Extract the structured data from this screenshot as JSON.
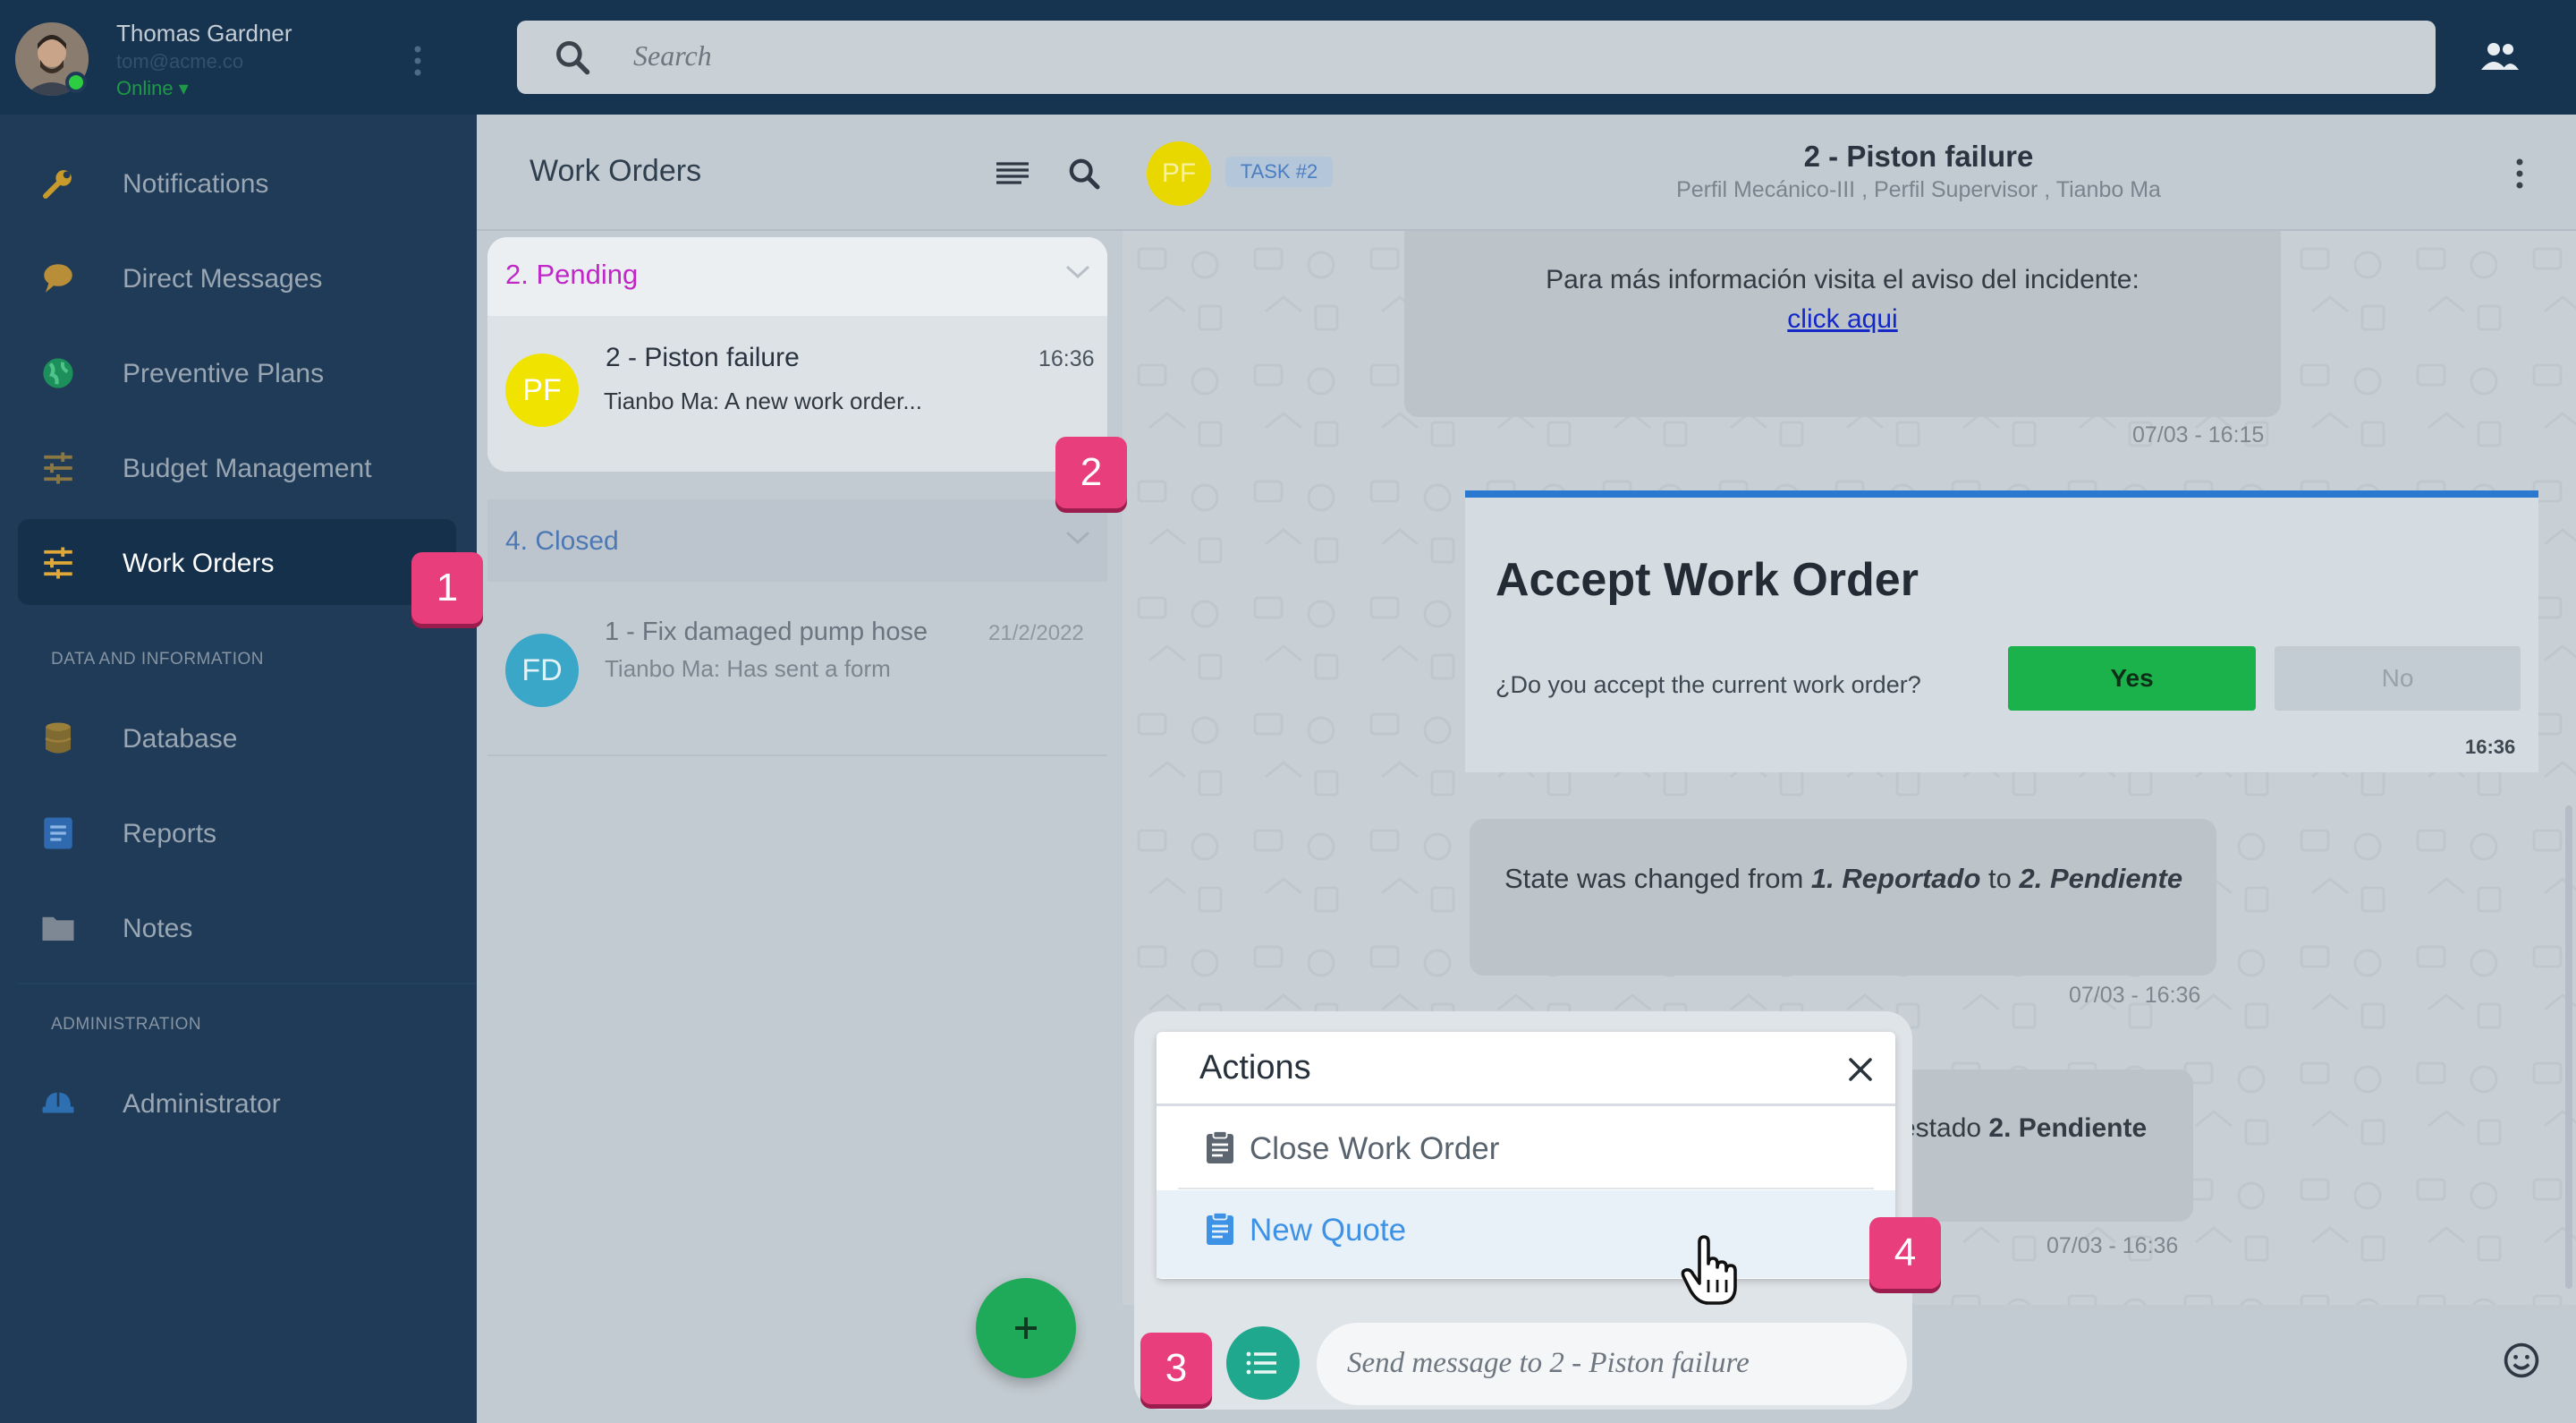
{
  "user": {
    "name": "Thomas Gardner",
    "email": "tom@acme.co",
    "status": "Online ▾"
  },
  "search": {
    "placeholder": "Search"
  },
  "sidebar": {
    "items": [
      {
        "label": "Notifications",
        "icon": "wrench-icon"
      },
      {
        "label": "Direct Messages",
        "icon": "chat-bubble-icon"
      },
      {
        "label": "Preventive Plans",
        "icon": "globe-icon"
      },
      {
        "label": "Budget Management",
        "icon": "sliders-icon"
      },
      {
        "label": "Work Orders",
        "icon": "sliders-icon"
      }
    ],
    "section_data": "DATA AND INFORMATION",
    "data_items": [
      {
        "label": "Database",
        "icon": "database-icon"
      },
      {
        "label": "Reports",
        "icon": "document-icon"
      },
      {
        "label": "Notes",
        "icon": "folder-icon"
      }
    ],
    "section_admin": "ADMINISTRATION",
    "admin_items": [
      {
        "label": "Administrator",
        "icon": "admin-icon"
      }
    ]
  },
  "list": {
    "title": "Work Orders",
    "groups": [
      {
        "label": "2. Pending",
        "items": [
          {
            "initials": "PF",
            "title": "2 - Piston failure",
            "time": "16:36",
            "preview": "Tianbo Ma: A new work order..."
          }
        ]
      },
      {
        "label": "4. Closed",
        "items": [
          {
            "initials": "FD",
            "title": "1 - Fix damaged pump hose",
            "time": "21/2/2022",
            "preview": "Tianbo Ma: Has sent a form"
          }
        ]
      }
    ]
  },
  "chat": {
    "avatar": "PF",
    "badge": "TASK #2",
    "title": "2 - Piston failure",
    "subtitle": "Perfil Mecánico-III , Perfil Supervisor , Tianbo Ma",
    "messages": [
      {
        "text": "Para más información visita el aviso del incidente:",
        "link": "click aqui",
        "time": "07/03 - 16:15"
      },
      {
        "pre": "State was changed from ",
        "from": "1. Reportado",
        "mid": " to ",
        "to": "2. Pendiente",
        "time": "07/03 - 16:36"
      },
      {
        "pre": "estado ",
        "to": "2. Pendiente",
        "time": "07/03 - 16:36"
      }
    ],
    "accept": {
      "title": "Accept Work Order",
      "question": "¿Do you accept the current work order?",
      "yes": "Yes",
      "no": "No",
      "time": "16:36"
    },
    "input_placeholder": "Send message to 2 - Piston failure"
  },
  "actions": {
    "title": "Actions",
    "items": [
      {
        "label": "Close Work Order",
        "icon": "clipboard-icon"
      },
      {
        "label": "New Quote",
        "icon": "clipboard-icon"
      }
    ]
  },
  "callouts": [
    "1",
    "2",
    "3",
    "4"
  ],
  "colors": {
    "sidebar": "#1f3b58",
    "accent_green": "#1bb24c",
    "pending": "#c026c8",
    "callout": "#e83e7c"
  }
}
